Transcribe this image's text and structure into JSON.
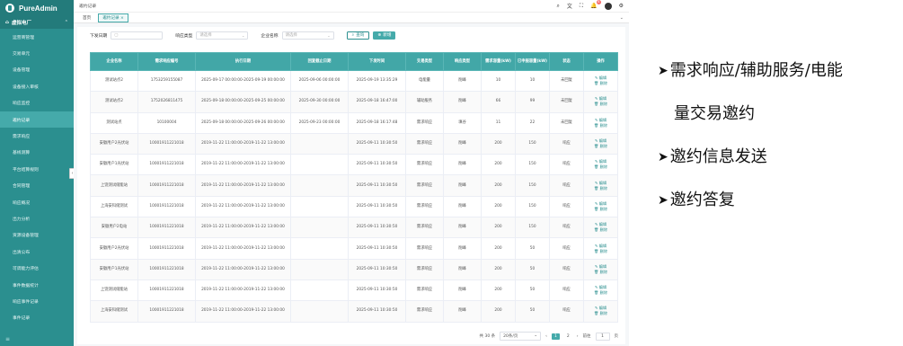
{
  "app": {
    "name": "PureAdmin"
  },
  "sidebar": {
    "group": "虚拟电厂",
    "items": [
      {
        "label": "运营商管理"
      },
      {
        "label": "交易单元"
      },
      {
        "label": "设备管理"
      },
      {
        "label": "设备接入审核"
      },
      {
        "label": "响应监控"
      },
      {
        "label": "邀约记录"
      },
      {
        "label": "需求响应"
      },
      {
        "label": "基线测算"
      },
      {
        "label": "平台结算规则"
      },
      {
        "label": "合同管理"
      },
      {
        "label": "响应概况"
      },
      {
        "label": "出力分析"
      },
      {
        "label": "资源设备管理"
      },
      {
        "label": "出清公布"
      },
      {
        "label": "可调能力评估"
      },
      {
        "label": "事件数据统计"
      },
      {
        "label": "响应事件记录"
      },
      {
        "label": "事件记录"
      }
    ],
    "active_index": 5
  },
  "topbar": {
    "breadcrumb": "邀约记录",
    "notify_count": "8"
  },
  "tabs": [
    {
      "label": "首页"
    },
    {
      "label": "邀约记录 ×"
    }
  ],
  "filters": {
    "date_label": "下发日期",
    "type_label": "响应类型",
    "type_placeholder": "请选择",
    "company_label": "企业名称",
    "company_placeholder": "请选择",
    "query_label": "查询",
    "add_label": "新增"
  },
  "table": {
    "headers": [
      "企业名称",
      "需求响应编号",
      "执行日期",
      "回复截止日期",
      "下发时间",
      "交易类型",
      "响应类型",
      "需求容量(kW)",
      "已申报容量(kW)",
      "状态",
      "操作"
    ],
    "rows": [
      [
        "测试站点2",
        "1753259155087",
        "2025-09-17 00:00:00-2025-09-19 00:00:00",
        "2025-09-06 00:00:00",
        "2025-09-19 13:35:29",
        "电能量",
        "削峰",
        "10",
        "10",
        "未回复"
      ],
      [
        "测试站点2",
        "1752026811475",
        "2025-09-18 00:00:00-2025-09-25 00:00:00",
        "2025-09-30 00:00:00",
        "2025-09-18 16:47:00",
        "辅助服务",
        "削峰",
        "66",
        "99",
        "未回复"
      ],
      [
        "测试站点",
        "10100004",
        "2025-09-18 00:00:00-2025-09-26 00:00:00",
        "2025-09-23 00:00:00",
        "2025-09-18 16:17:48",
        "需求响应",
        "填谷",
        "11",
        "22",
        "未回复"
      ],
      [
        "安徽用户2光伏站",
        "10001911221018",
        "2019-11-22 11:00:00-2019-11-22 13:00:00",
        "",
        "2025-09-11 10:30:50",
        "需求响应",
        "削峰",
        "200",
        "150",
        "响应"
      ],
      [
        "安徽用户1光伏站",
        "10001911221018",
        "2019-11-22 11:00:00-2019-11-22 13:00:00",
        "",
        "2025-09-11 10:30:50",
        "需求响应",
        "削峰",
        "200",
        "150",
        "响应"
      ],
      [
        "上饶测试储能站",
        "10001911221018",
        "2019-11-22 11:00:00-2019-11-22 13:00:00",
        "",
        "2025-09-11 10:30:50",
        "需求响应",
        "削峰",
        "200",
        "150",
        "响应"
      ],
      [
        "上海安科储测试",
        "10001911221018",
        "2019-11-22 11:00:00-2019-11-22 13:00:00",
        "",
        "2025-09-11 10:30:50",
        "需求响应",
        "削峰",
        "200",
        "150",
        "响应"
      ],
      [
        "安徽用户2电站",
        "10001911221018",
        "2019-11-22 11:00:00-2019-11-22 13:00:00",
        "",
        "2025-09-11 10:30:50",
        "需求响应",
        "削峰",
        "200",
        "150",
        "响应"
      ],
      [
        "安徽用户2光伏站",
        "10001911221018",
        "2019-11-22 11:00:00-2019-11-22 13:00:00",
        "",
        "2025-09-11 10:30:50",
        "需求响应",
        "削峰",
        "200",
        "50",
        "响应"
      ],
      [
        "安徽用户1光伏站",
        "10001911221018",
        "2019-11-22 11:00:00-2019-11-22 13:00:00",
        "",
        "2025-09-11 10:30:50",
        "需求响应",
        "削峰",
        "200",
        "50",
        "响应"
      ],
      [
        "上饶测试储能站",
        "10001911221018",
        "2019-11-22 11:00:00-2019-11-22 13:00:00",
        "",
        "2025-09-11 10:30:50",
        "需求响应",
        "削峰",
        "200",
        "50",
        "响应"
      ],
      [
        "上海安科储测试",
        "10001911221018",
        "2019-11-22 11:00:00-2019-11-22 13:00:00",
        "",
        "2025-09-11 10:30:50",
        "需求响应",
        "削峰",
        "200",
        "50",
        "响应"
      ]
    ],
    "edit_label": "编辑",
    "delete_label": "删除"
  },
  "pagination": {
    "total": "共 30 条",
    "page_size": "20条/页",
    "pages": [
      "1",
      "2"
    ],
    "goto_label": "前往",
    "goto_value": "1",
    "page_suffix": "页"
  },
  "notes": [
    {
      "line1": "需求响应/辅助服务/电能",
      "line2": "量交易邀约"
    },
    {
      "line1": "邀约信息发送"
    },
    {
      "line1": "邀约答复"
    }
  ]
}
